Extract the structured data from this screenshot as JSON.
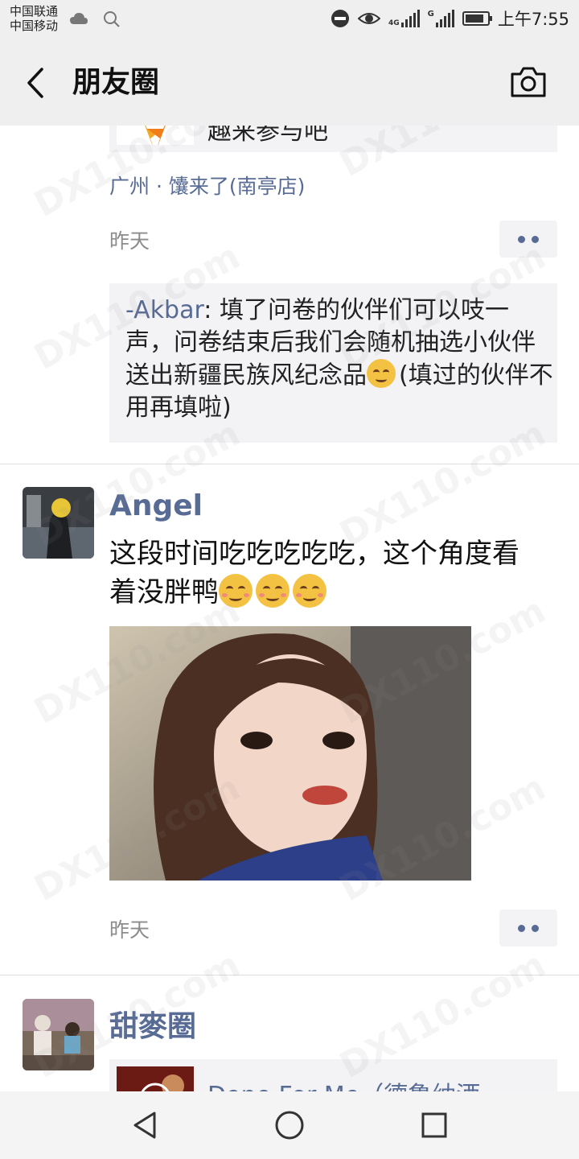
{
  "status_bar": {
    "carrier_1": "中国联通",
    "carrier_2": "中国移动",
    "network_1": "4G",
    "network_2": "G",
    "time": "上午7:55",
    "battery_level": 0.85
  },
  "nav": {
    "title": "朋友圈",
    "back_icon": "chevron-left-icon",
    "camera_icon": "camera-icon"
  },
  "post1": {
    "link_title": "趣来参与吧",
    "location": "广州 · 馕来了(南亭店)",
    "time": "昨天",
    "comment": {
      "author": "-Akbar",
      "text": ": 填了问卷的伙伴们可以吱一声，问卷结束后我们会随机抽选小伙伴送出新疆民族风纪念品",
      "text_after": "(填过的伙伴不用再填啦)"
    }
  },
  "post2": {
    "name": "Angel",
    "text": "这段时间吃吃吃吃吃，这个角度看着没胖鸭",
    "emoji_count": 3,
    "time": "昨天"
  },
  "post3": {
    "name": "甜麥圈",
    "link_title": "Done For Me（德鲁纳酒"
  },
  "watermark": "DX110.com"
}
